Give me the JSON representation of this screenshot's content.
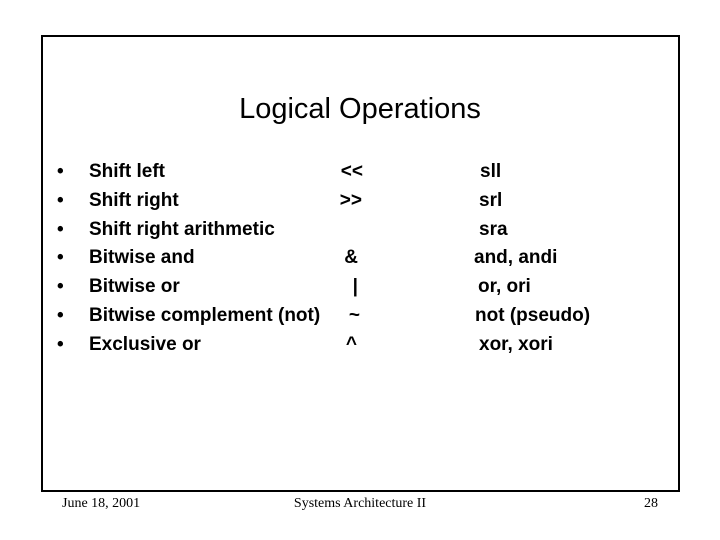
{
  "slide": {
    "title": "Logical Operations",
    "bullet_glyph": "•",
    "items": [
      {
        "label": "Shift left",
        "operator": "<<",
        "instruction": "sll"
      },
      {
        "label": "Shift right",
        "operator": ">>",
        "instruction": "srl"
      },
      {
        "label": "Shift right arithmetic",
        "operator": "",
        "instruction": "sra"
      },
      {
        "label": "Bitwise and",
        "operator": "&",
        "instruction": "and, andi"
      },
      {
        "label": "Bitwise or",
        "operator": "|",
        "instruction": "or, ori"
      },
      {
        "label": "Bitwise complement (not)",
        "operator": "~",
        "instruction": "not (pseudo)"
      },
      {
        "label": "Exclusive or",
        "operator": "^",
        "instruction": "xor, xori"
      }
    ]
  },
  "footer": {
    "date": "June 18, 2001",
    "course": "Systems Architecture II",
    "page_number": "28"
  }
}
